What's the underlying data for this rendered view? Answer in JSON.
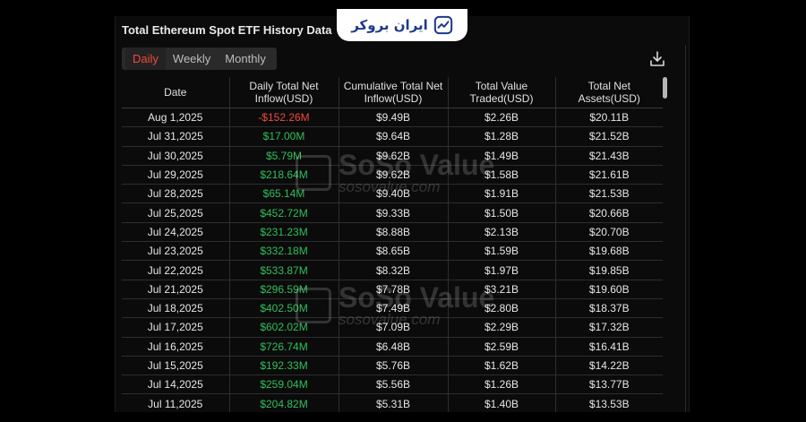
{
  "title": "Total Ethereum Spot ETF History Data",
  "logo_text": "ایران بروکر",
  "tabs": [
    "Daily",
    "Weekly",
    "Monthly"
  ],
  "active_tab": "Daily",
  "watermark": {
    "brand": "SoSo Value",
    "url": "sosovalue.com"
  },
  "columns": [
    "Date",
    "Daily Total Net Inflow(USD)",
    "Cumulative Total Net Inflow(USD)",
    "Total Value Traded(USD)",
    "Total Net Assets(USD)"
  ],
  "rows": [
    {
      "date": "Aug 1,2025",
      "inflow": "-$152.26M",
      "cum": "$9.49B",
      "traded": "$2.26B",
      "assets": "$20.11B"
    },
    {
      "date": "Jul 31,2025",
      "inflow": "$17.00M",
      "cum": "$9.64B",
      "traded": "$1.28B",
      "assets": "$21.52B"
    },
    {
      "date": "Jul 30,2025",
      "inflow": "$5.79M",
      "cum": "$9.62B",
      "traded": "$1.49B",
      "assets": "$21.43B"
    },
    {
      "date": "Jul 29,2025",
      "inflow": "$218.64M",
      "cum": "$9.62B",
      "traded": "$1.58B",
      "assets": "$21.61B"
    },
    {
      "date": "Jul 28,2025",
      "inflow": "$65.14M",
      "cum": "$9.40B",
      "traded": "$1.91B",
      "assets": "$21.53B"
    },
    {
      "date": "Jul 25,2025",
      "inflow": "$452.72M",
      "cum": "$9.33B",
      "traded": "$1.50B",
      "assets": "$20.66B"
    },
    {
      "date": "Jul 24,2025",
      "inflow": "$231.23M",
      "cum": "$8.88B",
      "traded": "$2.13B",
      "assets": "$20.70B"
    },
    {
      "date": "Jul 23,2025",
      "inflow": "$332.18M",
      "cum": "$8.65B",
      "traded": "$1.59B",
      "assets": "$19.68B"
    },
    {
      "date": "Jul 22,2025",
      "inflow": "$533.87M",
      "cum": "$8.32B",
      "traded": "$1.97B",
      "assets": "$19.85B"
    },
    {
      "date": "Jul 21,2025",
      "inflow": "$296.59M",
      "cum": "$7.78B",
      "traded": "$3.21B",
      "assets": "$19.60B"
    },
    {
      "date": "Jul 18,2025",
      "inflow": "$402.50M",
      "cum": "$7.49B",
      "traded": "$2.80B",
      "assets": "$18.37B"
    },
    {
      "date": "Jul 17,2025",
      "inflow": "$602.02M",
      "cum": "$7.09B",
      "traded": "$2.29B",
      "assets": "$17.32B"
    },
    {
      "date": "Jul 16,2025",
      "inflow": "$726.74M",
      "cum": "$6.48B",
      "traded": "$2.59B",
      "assets": "$16.41B"
    },
    {
      "date": "Jul 15,2025",
      "inflow": "$192.33M",
      "cum": "$5.76B",
      "traded": "$1.62B",
      "assets": "$14.22B"
    },
    {
      "date": "Jul 14,2025",
      "inflow": "$259.04M",
      "cum": "$5.56B",
      "traded": "$1.26B",
      "assets": "$13.77B"
    },
    {
      "date": "Jul 11,2025",
      "inflow": "$204.82M",
      "cum": "$5.31B",
      "traded": "$1.40B",
      "assets": "$13.53B"
    }
  ],
  "colors": {
    "positive": "#2fbf5b",
    "negative": "#f0493c",
    "active_tab": "#f04a3a",
    "logo": "#1e3a8a"
  },
  "icons": {
    "download": "download-icon",
    "logo": "trend-chart-icon"
  }
}
